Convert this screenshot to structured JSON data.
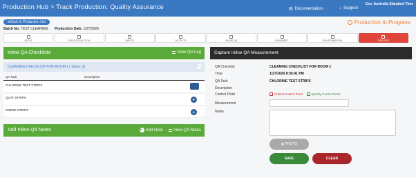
{
  "header": {
    "title": "Production Hub > Track Production: Quality Assurance",
    "documentation": "Documentation",
    "support": "Support",
    "timezone": "Cen. Australia Standard Time"
  },
  "back_label": "Back to Production List",
  "status": "Production In Progress",
  "batch": {
    "label": "Batch No:",
    "value": "TEST CLEANING"
  },
  "production_date": {
    "label": "Production Date:",
    "value": "1/27/2026"
  },
  "tabs": [
    {
      "label": "SETUP",
      "icon": "gear-icon"
    },
    {
      "label": "PRE-PRODUCTION",
      "icon": "clipboard-icon"
    },
    {
      "label": "INPUTS",
      "icon": "download-icon"
    },
    {
      "label": "OUTPUTS",
      "icon": "video-icon"
    },
    {
      "label": "INLINE QA",
      "icon": "list-icon"
    },
    {
      "label": "RUNSHEET",
      "icon": "clock-icon"
    },
    {
      "label": "ENVIRONMENTAL",
      "icon": "warning-icon"
    },
    {
      "label": "SIGN-OFF",
      "icon": "pen-icon",
      "active": true
    }
  ],
  "inline_qa": {
    "title": "Inline QA Checklists",
    "view_log": "View QA Log",
    "checklist": "CLEANING CHECKLIST FOR ROOM 1 [ Tasks: 3]",
    "col_task": "QA Task",
    "col_desc": "Description",
    "tasks": [
      "CHLORINE TEST STRIPS",
      "QUAT STRIPS",
      "IODINE STRIPS"
    ]
  },
  "notes": {
    "title": "Add Inline QA Notes",
    "add": "Add Note",
    "view": "View QA Notes"
  },
  "capture": {
    "title": "Capture Inline QA Measurement",
    "fields": {
      "checklist_label": "QA Checklist",
      "checklist_value": "CLEANING CHECKLIST FOR ROOM 1",
      "time_label": "Time",
      "time_value": "1/27/2026 8:36:41 PM",
      "task_label": "QA Task",
      "task_value": "CHLORINE TEST STRIPS",
      "description_label": "Description",
      "control_label": "Control Point",
      "critical": "Critical Control Point",
      "quality": "Quality Control Point",
      "measurement_label": "Measurement",
      "notes_label": "Notes"
    },
    "photo": "PHOTO",
    "save": "SAVE",
    "clear": "CLEAR"
  },
  "colors": {
    "header": "#3a78c2",
    "green": "#5aaa3a",
    "active_tab": "#e0453a",
    "status": "#e8823a",
    "save": "#3a8a3a",
    "clear": "#a9262b"
  }
}
